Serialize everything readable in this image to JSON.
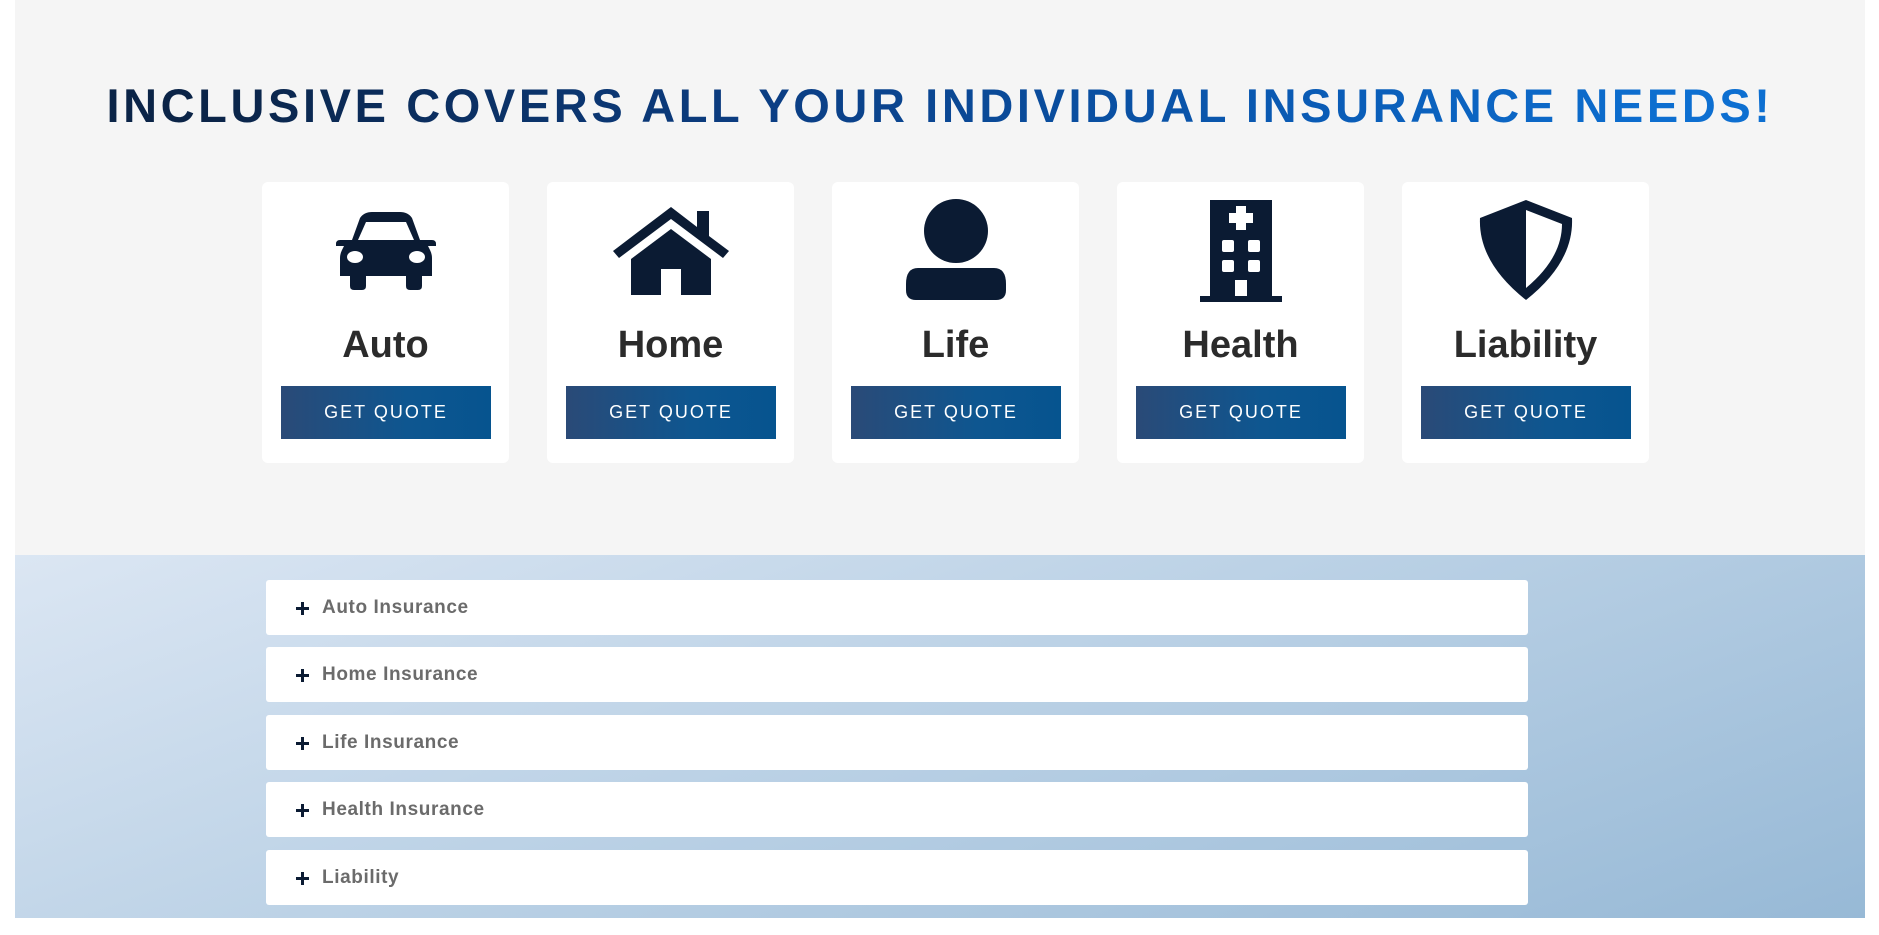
{
  "headline": "INCLUSIVE COVERS ALL YOUR INDIVIDUAL INSURANCE NEEDS!",
  "colors": {
    "headline_dark": "#0b2447",
    "headline_light": "#0d6fd1",
    "icon": "#0b1b33",
    "button_start": "#2a4a77",
    "button_end": "#06548f",
    "section_bg": "#f5f5f5"
  },
  "cards": [
    {
      "label": "Auto",
      "icon": "car-icon",
      "button": "GET QUOTE"
    },
    {
      "label": "Home",
      "icon": "house-icon",
      "button": "GET QUOTE"
    },
    {
      "label": "Life",
      "icon": "person-icon",
      "button": "GET QUOTE"
    },
    {
      "label": "Health",
      "icon": "hospital-icon",
      "button": "GET QUOTE"
    },
    {
      "label": "Liability",
      "icon": "shield-icon",
      "button": "GET QUOTE"
    }
  ],
  "accordion": [
    {
      "title": "Auto Insurance",
      "icon": "plus-icon"
    },
    {
      "title": "Home Insurance",
      "icon": "plus-icon"
    },
    {
      "title": "Life Insurance",
      "icon": "plus-icon"
    },
    {
      "title": "Health Insurance",
      "icon": "plus-icon"
    },
    {
      "title": "Liability",
      "icon": "plus-icon"
    }
  ]
}
